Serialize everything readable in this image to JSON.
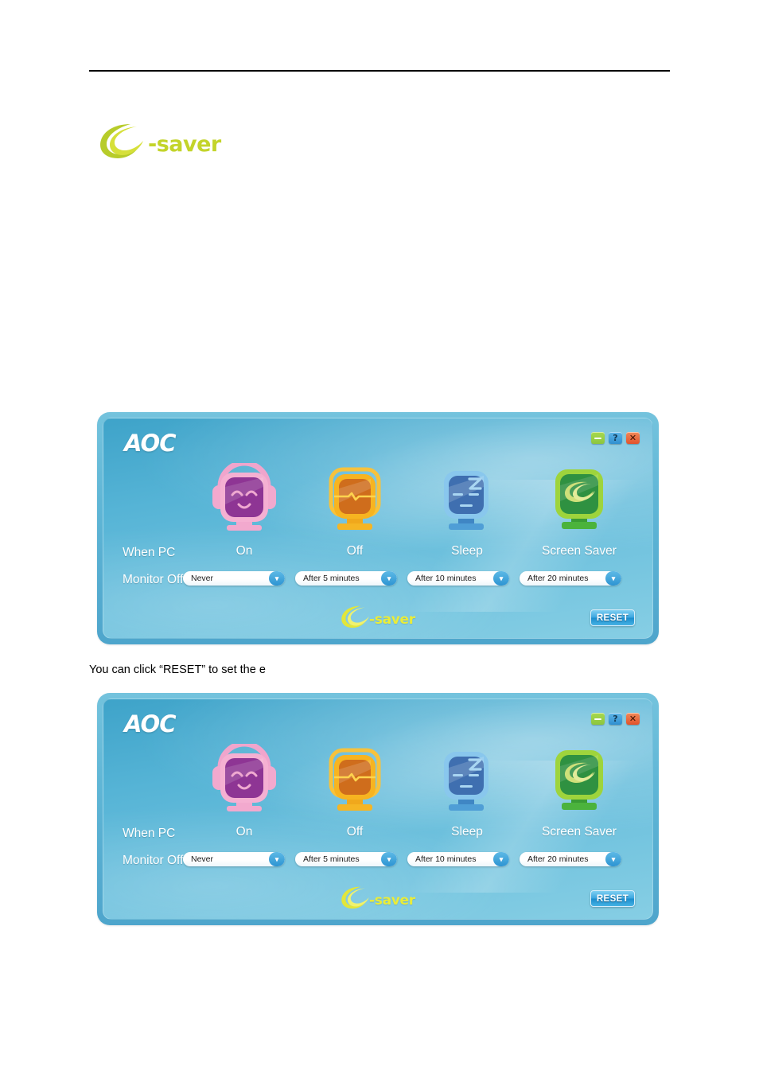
{
  "document": {
    "brand_logo": {
      "word": "-saver",
      "icon": "e-saver-swoosh-icon",
      "color": "#c3d42a"
    },
    "caption": "You can click “RESET” to set the e"
  },
  "app_window": {
    "brand": "AOC",
    "controls": [
      {
        "name": "minimize-button",
        "glyph": "–",
        "color": "#8cc63e"
      },
      {
        "name": "help-button",
        "glyph": "?",
        "color": "#2f8fd0"
      },
      {
        "name": "close-button",
        "glyph": "✕",
        "color": "#e2522b"
      }
    ],
    "row_labels": {
      "when_pc": "When  PC",
      "monitor_off": "Monitor  Off"
    },
    "states": [
      {
        "label": "On",
        "icon": "monitor-headphones-happy-icon",
        "icon_color": "#9b3fa0",
        "frame_color": "#f3a8cf",
        "timeout": "Never"
      },
      {
        "label": "Off",
        "icon": "monitor-flatline-icon",
        "icon_color": "#d26a1d",
        "frame_color": "#f5b222",
        "timeout": "After 5 minutes"
      },
      {
        "label": "Sleep",
        "icon": "monitor-sleeping-z-icon",
        "icon_color": "#3a74b8",
        "frame_color": "#7fc2ea",
        "timeout": "After 10 minutes"
      },
      {
        "label": "Screen Saver",
        "icon": "monitor-esaver-swoosh-icon",
        "icon_color": "#2f9a3e",
        "frame_color": "#9ad43a",
        "timeout": "After 20 minutes"
      }
    ],
    "footer_logo": {
      "word": "-saver",
      "icon": "e-saver-swoosh-icon",
      "color": "#e9ec3a"
    },
    "reset_label": "RESET"
  }
}
